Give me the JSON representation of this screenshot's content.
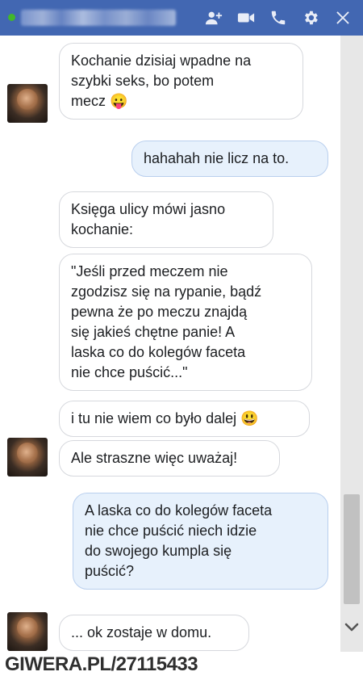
{
  "window": {
    "contact_name_blurred": "",
    "icons": [
      "add-people-icon",
      "video-call-icon",
      "phone-icon",
      "gear-icon",
      "close-icon"
    ],
    "accent": "#4267b2",
    "online_color": "#42b72a"
  },
  "messages": [
    {
      "side": "in",
      "lines": [
        "Kochanie dzisiaj wpadne na",
        "szybki seks, bo  potem",
        "mecz 😛"
      ]
    },
    {
      "side": "out",
      "lines": [
        "hahahah nie licz na to."
      ]
    },
    {
      "side": "in",
      "lines": [
        "Księga ulicy mówi jasno",
        "kochanie:"
      ]
    },
    {
      "side": "in",
      "lines": [
        "\"Jeśli przed meczem nie",
        "zgodzisz się na rypanie, bądź",
        "pewna że po meczu znajdą",
        "się jakieś chętne panie! A",
        "laska co do kolegów faceta",
        "nie chce puścić...\""
      ]
    },
    {
      "side": "in",
      "lines": [
        "i tu nie wiem co było dalej 😃"
      ]
    },
    {
      "side": "in",
      "lines": [
        "Ale straszne więc uważaj!"
      ]
    },
    {
      "side": "out",
      "lines": [
        "A laska co do kolegów faceta",
        "nie chce puścić niech idzie",
        "do swojego kumpla się",
        "puścić?"
      ]
    },
    {
      "side": "in",
      "lines": [
        "... ok zostaje w domu."
      ]
    }
  ],
  "watermark": "GIWERA.PL/27115433"
}
